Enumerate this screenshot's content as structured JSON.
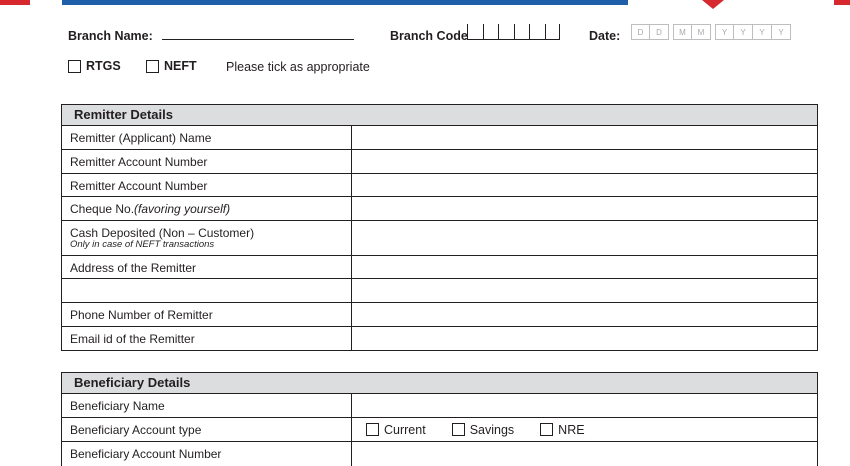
{
  "header": {
    "branch_name_label": "Branch Name:",
    "branch_code_label": "Branch Code",
    "date_label": "Date:",
    "date_day_cells": [
      "D",
      "D"
    ],
    "date_month_cells": [
      "M",
      "M"
    ],
    "date_year_cells": [
      "Y",
      "Y",
      "Y",
      "Y"
    ]
  },
  "transfer_type": {
    "rtgs_label": "RTGS",
    "neft_label": "NEFT",
    "note": "Please tick as appropriate"
  },
  "remitter": {
    "title": "Remitter Details",
    "rows": [
      {
        "label": "Remitter (Applicant) Name"
      },
      {
        "label": "Remitter Account Number"
      },
      {
        "label": "Remitter Account Number"
      },
      {
        "label": "Cheque No.",
        "label_italic": "(favoring yourself)"
      },
      {
        "label": "Cash Deposited (Non – Customer)",
        "sublabel": "Only in case of NEFT transactions"
      },
      {
        "label": "Address of the Remitter"
      },
      {
        "label": ""
      },
      {
        "label": "Phone Number of Remitter"
      },
      {
        "label": "Email id of the Remitter"
      }
    ]
  },
  "beneficiary": {
    "title": "Beneficiary Details",
    "rows": [
      {
        "label": "Beneficiary Name"
      },
      {
        "label": "Beneficiary Account type"
      },
      {
        "label": "Beneficiary Account Number"
      }
    ],
    "account_types": [
      "Current",
      "Savings",
      "NRE"
    ]
  },
  "colors": {
    "accent_blue": "#1f5faa",
    "accent_red": "#d7282f",
    "header_fill": "#dcdddf"
  }
}
